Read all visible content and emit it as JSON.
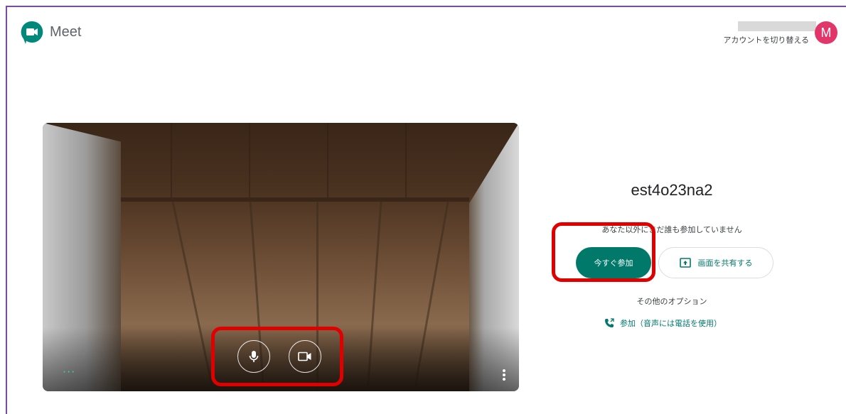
{
  "header": {
    "brand": "Meet",
    "switch_account": "アカウントを切り替える",
    "avatar_initial": "M"
  },
  "preview": {
    "menu_dots": "···"
  },
  "meeting": {
    "code": "est4o23na2",
    "status": "あなた以外にまだ誰も参加していません",
    "join_button": "今すぐ参加",
    "share_button": "画面を共有する",
    "other_options": "その他のオプション",
    "phone_join": "参加（音声には電話を使用）"
  },
  "colors": {
    "accent": "#00796b",
    "avatar": "#e2356a",
    "highlight": "#e00000",
    "frame": "#7a4aa6"
  },
  "icons": [
    "meet-logo-icon",
    "microphone-icon",
    "camera-icon",
    "more-vert-icon",
    "present-screen-icon",
    "phone-icon"
  ]
}
